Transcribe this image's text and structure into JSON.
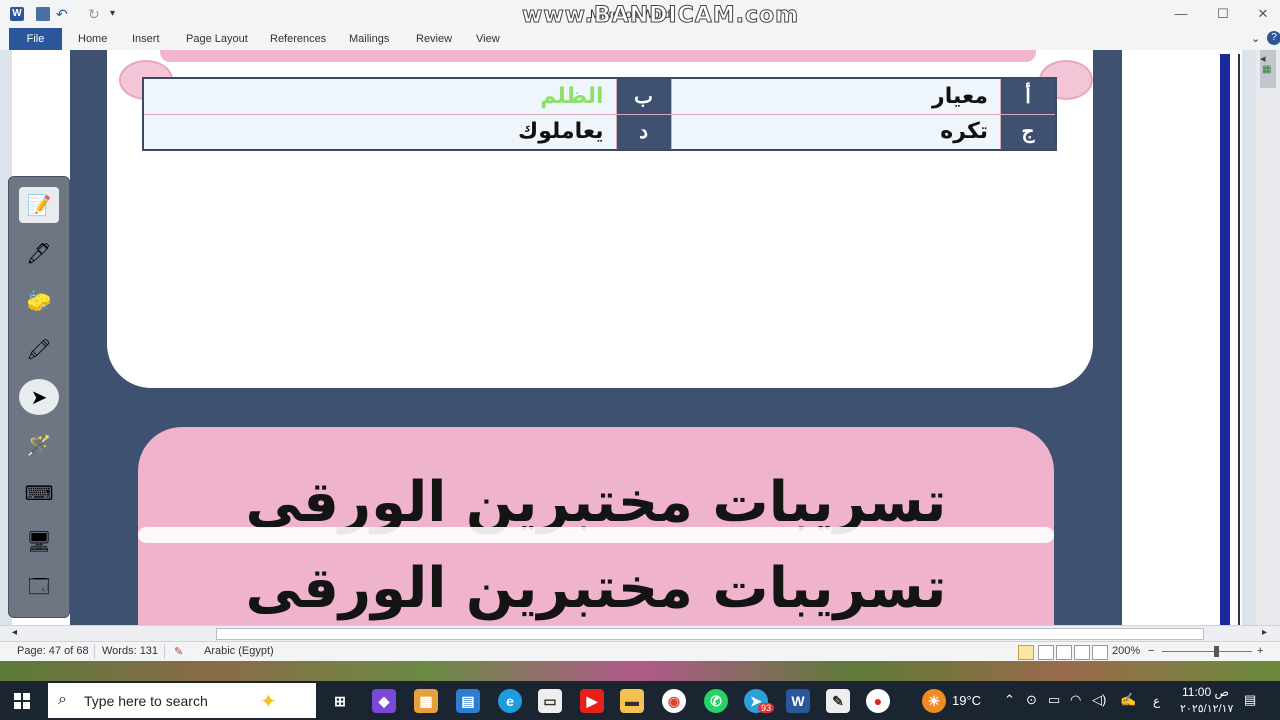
{
  "window": {
    "title": "Microsoft Word",
    "watermark": "www.BANDICAM.com",
    "app_icon_letter": "W"
  },
  "ribbon": {
    "tabs": [
      "File",
      "Home",
      "Insert",
      "Page Layout",
      "References",
      "Mailings",
      "Review",
      "View"
    ]
  },
  "document": {
    "answer_table": {
      "rows": [
        {
          "letter_a": "أ",
          "text_a": "معيار",
          "letter_b": "ب",
          "text_b": "الظلم"
        },
        {
          "letter_a": "ج",
          "text_a": "تكره",
          "letter_b": "د",
          "text_b": "يعاملوك"
        }
      ]
    },
    "banner_lines": [
      "تسريبات مختبرين الورقى",
      "تسريبات مختبرين الورقى"
    ]
  },
  "status_bar": {
    "page": "Page: 47 of 68",
    "words": "Words: 131",
    "language": "Arabic (Egypt)",
    "zoom": "200%",
    "zoom_minus": "−",
    "zoom_plus": "+"
  },
  "taskbar": {
    "search_placeholder": "Type here to search",
    "temperature": "19°C",
    "time": "11:00 ص",
    "date": "٢٠٢٥/١٢/١٧",
    "language": "ع",
    "notification_badge": "93"
  },
  "colors": {
    "frame": "#3f5170",
    "pink": "#f0b3cd",
    "accent_green": "#8ee06a",
    "word_blue": "#2b579a"
  }
}
